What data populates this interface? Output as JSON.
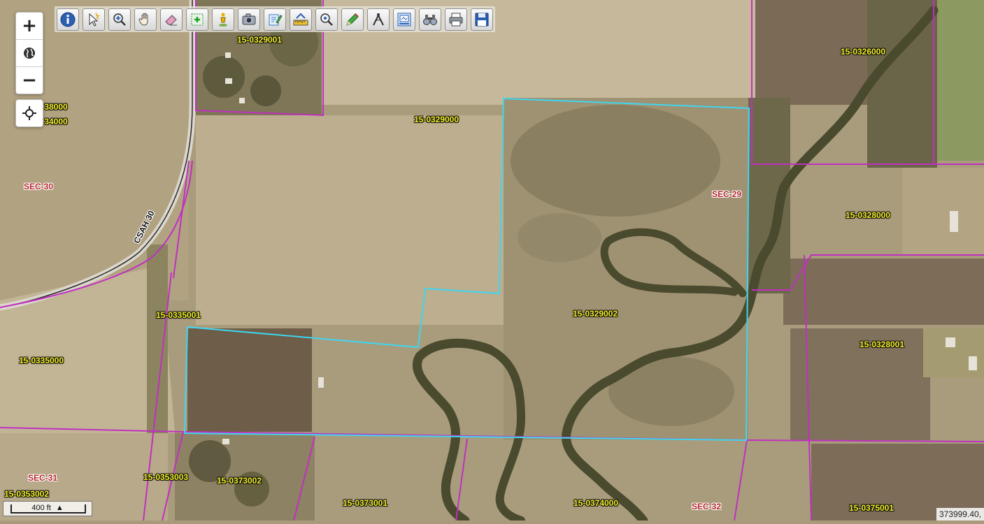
{
  "map": {
    "colors": {
      "parcel_line": "#c030c0",
      "selected_parcel": "#3fd6f0",
      "parcel_label": "#f2ee24",
      "section_label": "#b3262a",
      "river": "#4a4a2e"
    },
    "zoom_in_label": "+",
    "zoom_out_label": "−",
    "scale_label": "400 ft",
    "coordinate_readout": "373999.40,",
    "road_label": "CSAH 30",
    "parcels": [
      "15-0329001",
      "15-0326000",
      "15-0329000",
      "38000",
      "34000",
      "15-0328000",
      "15-0335001",
      "15-0329002",
      "15-0328001",
      "15-0335000",
      "15-0353003",
      "15-0373002",
      "15-0353002",
      "15-0373001",
      "15-0374000",
      "15-0375001"
    ],
    "sections": [
      "SEC-30",
      "SEC-29",
      "SEC-31",
      "SEC-32"
    ]
  },
  "toolbar": {
    "tools": [
      {
        "name": "info-icon",
        "title": "Identify"
      },
      {
        "name": "select-icon",
        "title": "Select"
      },
      {
        "name": "zoom-in-tool-icon",
        "title": "Zoom In"
      },
      {
        "name": "pan-hand-icon",
        "title": "Pan"
      },
      {
        "name": "eraser-icon",
        "title": "Clear"
      },
      {
        "name": "select-box-icon",
        "title": "Box Select"
      },
      {
        "name": "street-view-icon",
        "title": "Street View"
      },
      {
        "name": "camera-icon",
        "title": "Photos"
      },
      {
        "name": "edit-document-icon",
        "title": "Edit"
      },
      {
        "name": "measure-icon",
        "title": "Measure"
      },
      {
        "name": "search-icon",
        "title": "Search"
      },
      {
        "name": "pencil-icon",
        "title": "Draw"
      },
      {
        "name": "compass-icon",
        "title": "Measure Angle"
      },
      {
        "name": "layers-icon",
        "title": "Layers"
      },
      {
        "name": "binoculars-icon",
        "title": "Overview"
      },
      {
        "name": "print-icon",
        "title": "Print"
      },
      {
        "name": "save-icon",
        "title": "Save"
      }
    ]
  }
}
